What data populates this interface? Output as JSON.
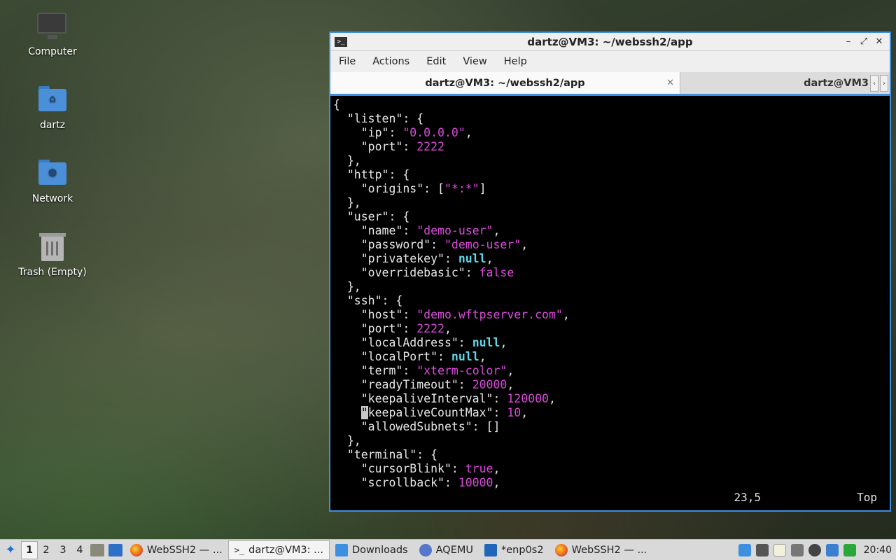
{
  "desktop": {
    "icons": [
      {
        "label": "Computer"
      },
      {
        "label": "dartz"
      },
      {
        "label": "Network"
      },
      {
        "label": "Trash (Empty)"
      }
    ]
  },
  "window": {
    "title": "dartz@VM3: ~/webssh2/app",
    "buttons": {
      "minimize": "–",
      "maximize": "⤢",
      "close": "✕"
    },
    "menu": [
      "File",
      "Actions",
      "Edit",
      "View",
      "Help"
    ],
    "tabs": [
      {
        "label": "dartz@VM3: ~/webssh2/app",
        "close": "✕"
      },
      {
        "label": "dartz@VM3"
      }
    ],
    "tab_scroll": {
      "left": "‹",
      "right": "›"
    },
    "terminal_lines": [
      [
        {
          "t": "{"
        }
      ],
      [
        {
          "t": "  \"listen\": {"
        }
      ],
      [
        {
          "t": "    \"ip\": "
        },
        {
          "t": "\"0.0.0.0\"",
          "c": "s"
        },
        {
          "t": ","
        }
      ],
      [
        {
          "t": "    \"port\": "
        },
        {
          "t": "2222",
          "c": "s"
        }
      ],
      [
        {
          "t": "  },"
        }
      ],
      [
        {
          "t": "  \"http\": {"
        }
      ],
      [
        {
          "t": "    \"origins\": ["
        },
        {
          "t": "\"*:*\"",
          "c": "s"
        },
        {
          "t": "]"
        }
      ],
      [
        {
          "t": "  },"
        }
      ],
      [
        {
          "t": "  \"user\": {"
        }
      ],
      [
        {
          "t": "    \"name\": "
        },
        {
          "t": "\"demo-user\"",
          "c": "s"
        },
        {
          "t": ","
        }
      ],
      [
        {
          "t": "    \"password\": "
        },
        {
          "t": "\"demo-user\"",
          "c": "s"
        },
        {
          "t": ","
        }
      ],
      [
        {
          "t": "    \"privatekey\": "
        },
        {
          "t": "null",
          "c": "k"
        },
        {
          "t": ","
        }
      ],
      [
        {
          "t": "    \"overridebasic\": "
        },
        {
          "t": "false",
          "c": "s"
        }
      ],
      [
        {
          "t": "  },"
        }
      ],
      [
        {
          "t": "  \"ssh\": {"
        }
      ],
      [
        {
          "t": "    \"host\": "
        },
        {
          "t": "\"demo.wftpserver.com\"",
          "c": "s"
        },
        {
          "t": ","
        }
      ],
      [
        {
          "t": "    \"port\": "
        },
        {
          "t": "2222",
          "c": "s"
        },
        {
          "t": ","
        }
      ],
      [
        {
          "t": "    \"localAddress\": "
        },
        {
          "t": "null",
          "c": "k"
        },
        {
          "t": ","
        }
      ],
      [
        {
          "t": "    \"localPort\": "
        },
        {
          "t": "null",
          "c": "k"
        },
        {
          "t": ","
        }
      ],
      [
        {
          "t": "    \"term\": "
        },
        {
          "t": "\"xterm-color\"",
          "c": "s"
        },
        {
          "t": ","
        }
      ],
      [
        {
          "t": "    \"readyTimeout\": "
        },
        {
          "t": "20000",
          "c": "s"
        },
        {
          "t": ","
        }
      ],
      [
        {
          "t": "    \"keepaliveInterval\": "
        },
        {
          "t": "120000",
          "c": "s"
        },
        {
          "t": ","
        }
      ],
      [
        {
          "t": "    "
        },
        {
          "t": "\"",
          "c": "cursor"
        },
        {
          "t": "keepaliveCountMax\": "
        },
        {
          "t": "10",
          "c": "s"
        },
        {
          "t": ","
        }
      ],
      [
        {
          "t": "    \"allowedSubnets\": []"
        }
      ],
      [
        {
          "t": "  },"
        }
      ],
      [
        {
          "t": "  \"terminal\": {"
        }
      ],
      [
        {
          "t": "    \"cursorBlink\": "
        },
        {
          "t": "true",
          "c": "s"
        },
        {
          "t": ","
        }
      ],
      [
        {
          "t": "    \"scrollback\": "
        },
        {
          "t": "10000",
          "c": "s"
        },
        {
          "t": ","
        }
      ]
    ],
    "status": {
      "position": "23,5",
      "scroll": "Top"
    }
  },
  "taskbar": {
    "workspaces": [
      "1",
      "2",
      "3",
      "4"
    ],
    "tasks": [
      {
        "label": "WebSSH2 — ...",
        "icon": "firefox-icon",
        "active": false
      },
      {
        "label": "dartz@VM3: ...",
        "icon": "terminal-icon",
        "active": true
      },
      {
        "label": "Downloads",
        "icon": "folder-icon",
        "active": false
      },
      {
        "label": "AQEMU",
        "icon": "aqemu-icon",
        "active": false
      },
      {
        "label": "*enp0s2",
        "icon": "wireshark-icon",
        "active": false
      },
      {
        "label": "WebSSH2 — ...",
        "icon": "firefox-icon",
        "active": false
      }
    ],
    "clock": "20:40"
  },
  "colors": {
    "accent": "#3d8fe0",
    "string": "#d94bd9",
    "keyword": "#5fd7e8"
  }
}
